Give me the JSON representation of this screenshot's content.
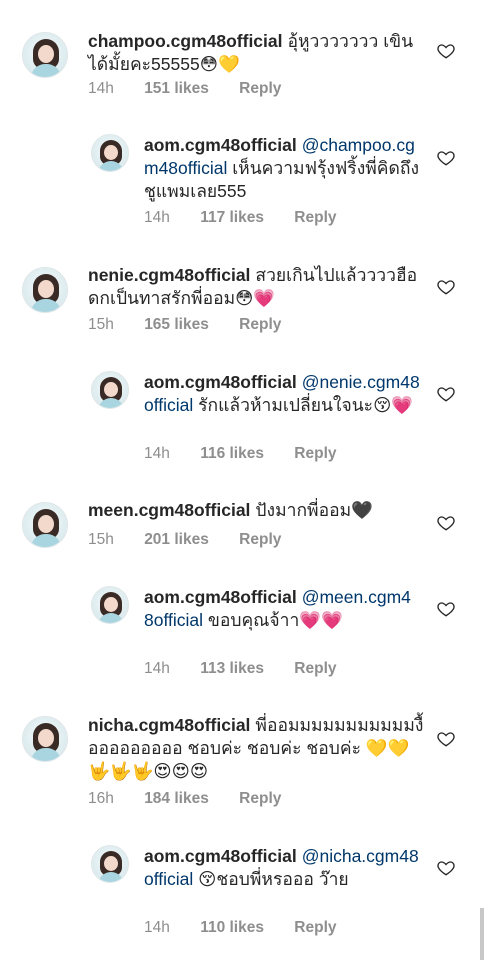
{
  "comments": [
    {
      "username": "champoo.cgm48official",
      "mention": "",
      "text": "อุ้หูววววววว เขินได้มั้ยคะ55555😳💛",
      "time": "14h",
      "likes": "151 likes",
      "reply": "Reply"
    },
    {
      "username": "aom.cgm48official",
      "mention": "@champoo.cgm48official",
      "text": " เห็นความฟรุ้งฟริ้งพี่คิดถึงชูแพมเลย555",
      "time": "14h",
      "likes": "117 likes",
      "reply": "Reply"
    },
    {
      "username": "nenie.cgm48official",
      "mention": "",
      "text": "สวยเกินไปแล้ววววฮือดกเป็นทาสรักพี่ออม😳💗",
      "time": "15h",
      "likes": "165 likes",
      "reply": "Reply"
    },
    {
      "username": "aom.cgm48official",
      "mention": "@nenie.cgm48official",
      "text": " รักแล้วห้ามเปลี่ยนใจนะ😚💗",
      "time": "14h",
      "likes": "116 likes",
      "reply": "Reply"
    },
    {
      "username": "meen.cgm48official",
      "mention": "",
      "text": "ปังมากพี่ออม🖤",
      "time": "15h",
      "likes": "201 likes",
      "reply": "Reply"
    },
    {
      "username": "aom.cgm48official",
      "mention": "@meen.cgm48official",
      "text": " ขอบคุณจ้าา💗💗",
      "time": "14h",
      "likes": "113 likes",
      "reply": "Reply"
    },
    {
      "username": "nicha.cgm48official",
      "mention": "",
      "text": "พี่ออมมมมมมมมมมมงื้อออออออออ ชอบค่ะ ชอบค่ะ ชอบค่ะ 💛💛🤟🤟🤟😍😍😍",
      "time": "16h",
      "likes": "184 likes",
      "reply": "Reply"
    },
    {
      "username": "aom.cgm48official",
      "mention": "@nicha.cgm48official",
      "text": " 😚ชอบพี่หรอออ ว๊าย",
      "time": "14h",
      "likes": "110 likes",
      "reply": "Reply"
    }
  ]
}
